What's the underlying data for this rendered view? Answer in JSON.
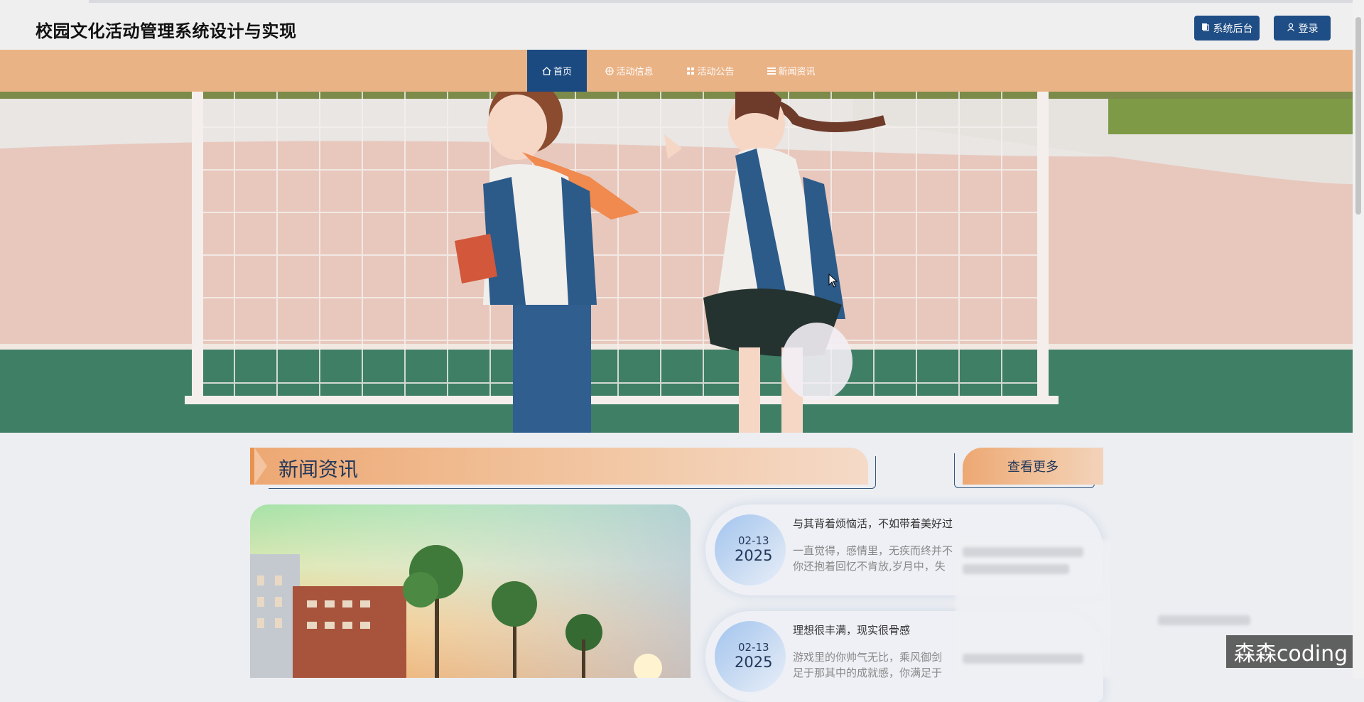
{
  "header": {
    "title": "校园文化活动管理系统设计与实现",
    "admin_button": "系统后台",
    "login_button": "登录"
  },
  "nav": {
    "items": [
      {
        "label": "首页",
        "icon": "home-icon",
        "active": true
      },
      {
        "label": "活动信息",
        "icon": "activity-icon",
        "active": false
      },
      {
        "label": "活动公告",
        "icon": "grid-icon",
        "active": false
      },
      {
        "label": "新闻资讯",
        "icon": "list-icon",
        "active": false
      }
    ]
  },
  "news_section": {
    "title": "新闻资讯",
    "more_button": "查看更多",
    "items": [
      {
        "date_md": "02-13",
        "date_year": "2025",
        "title": "与其背着烦恼活，不如带着美好过",
        "excerpt_line1": "一直觉得，感情里，无疾而终并不",
        "excerpt_line2": "你还抱着回忆不肯放,岁月中，失"
      },
      {
        "date_md": "02-13",
        "date_year": "2025",
        "title": "理想很丰满，现实很骨感",
        "excerpt_line1": "游戏里的你帅气无比，乘风御剑",
        "excerpt_line2": "足于那其中的成就感，你满足于"
      }
    ]
  },
  "watermark": "森森coding",
  "colors": {
    "nav_bg": "#eab386",
    "primary": "#1f4d85",
    "page_bg": "#eceef2"
  }
}
